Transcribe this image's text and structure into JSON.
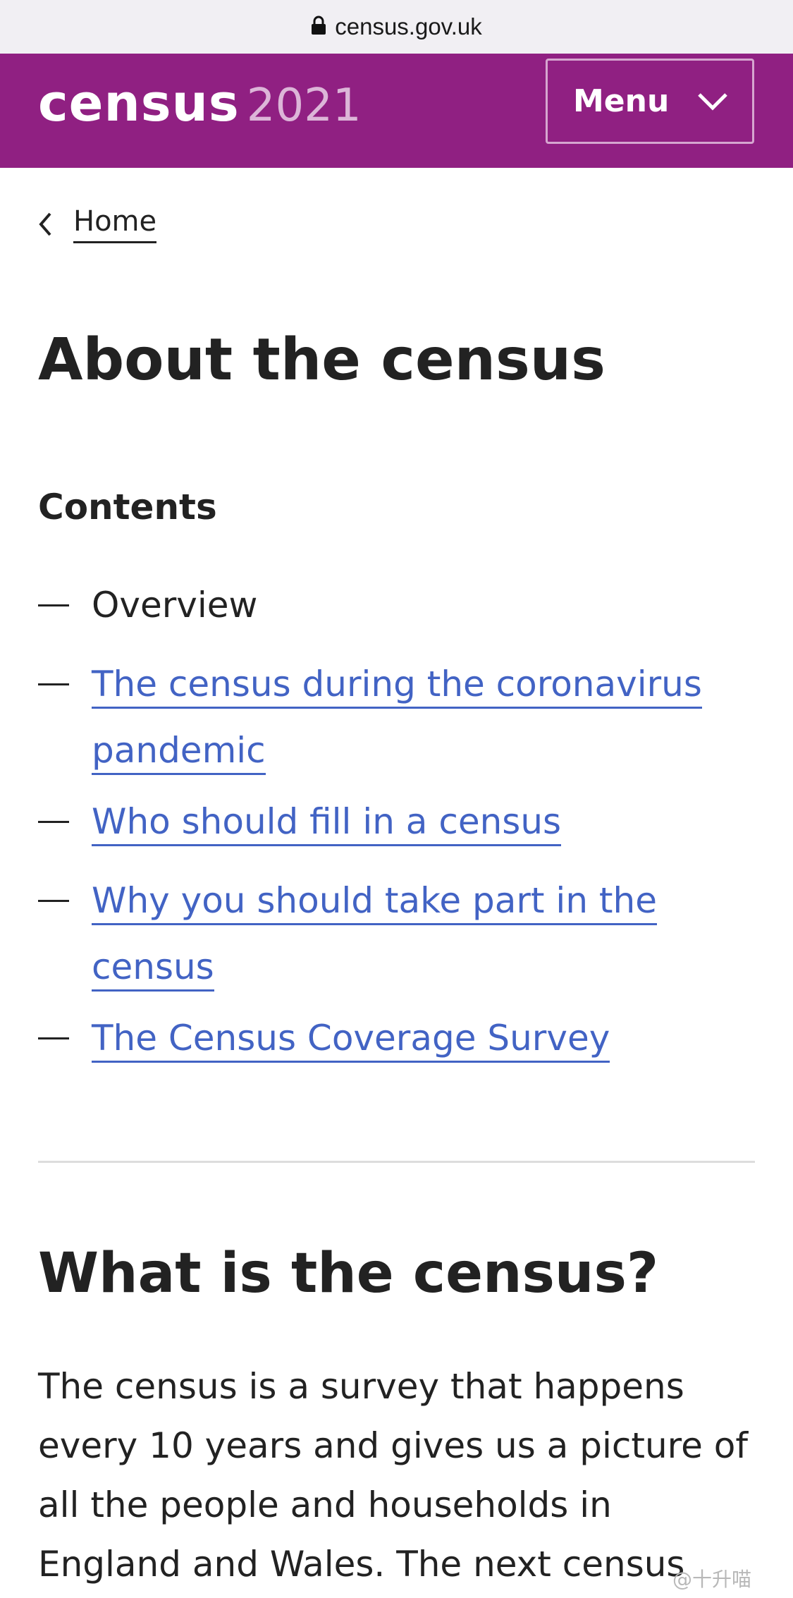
{
  "browser": {
    "url": "census.gov.uk",
    "lock_icon": "lock-icon"
  },
  "header": {
    "logo_word": "census",
    "logo_year": "2021",
    "menu_label": "Menu",
    "menu_icon": "chevron-down-icon",
    "background": "#902082"
  },
  "breadcrumb": {
    "label": "Home",
    "icon": "chevron-left-icon"
  },
  "page_title": "About the census",
  "contents": {
    "heading": "Contents",
    "items": [
      {
        "lines": [
          "Overview"
        ],
        "is_link": false
      },
      {
        "lines": [
          "The census during the coronavirus",
          "pandemic"
        ],
        "is_link": true
      },
      {
        "lines": [
          "Who should fill in a census"
        ],
        "is_link": true
      },
      {
        "lines": [
          "Why you should take part in the",
          "census"
        ],
        "is_link": true
      },
      {
        "lines": [
          "The Census Coverage Survey"
        ],
        "is_link": true
      }
    ],
    "link_color": "#4263c4"
  },
  "section": {
    "heading": "What is the census?",
    "body_lines": [
      "The census is a survey that happens",
      "every 10 years and gives us a picture of",
      "all the people and households in",
      "England and Wales. The next census"
    ]
  },
  "watermark": "@十升喵"
}
